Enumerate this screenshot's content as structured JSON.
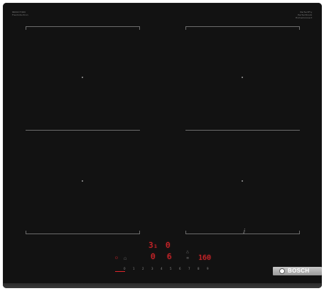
{
  "top_left_label": {
    "line1": "INDUCTION",
    "line2": "FlexInduction"
  },
  "top_right_label": {
    "line1": "PerfectFry",
    "line2": "PerfectCook",
    "line3": "HomeConnect"
  },
  "control_panel": {
    "display_left_top": "3₁",
    "display_left_mid": "0",
    "display_right_top": "0",
    "display_right_mid": "6",
    "power_symbol": "⏻",
    "lock_symbol": "☖",
    "timer_display": "160",
    "slider_numbers": [
      "0",
      "1",
      "2",
      "3",
      "4",
      "5",
      "6",
      "7",
      "8",
      "9"
    ],
    "slider_active_value": 0
  },
  "brand": {
    "name": "BOSCH"
  },
  "colors": {
    "glass": "#121212",
    "display_red": "#e0262b",
    "zone_marking": "#6c6c6c",
    "brand_plate": "#b0b0b0"
  },
  "icons": {
    "flex_zone": "flex-induction-icon",
    "brand_logo": "bosch-logo-icon"
  }
}
